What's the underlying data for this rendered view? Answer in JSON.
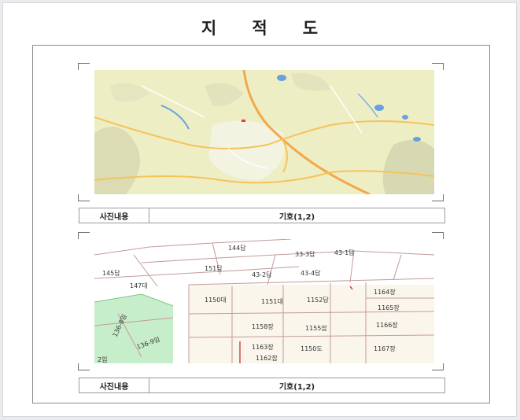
{
  "document": {
    "title": "지 적 도"
  },
  "panels": [
    {
      "image": "topographic-location-map",
      "caption_label": "사진내용",
      "caption_value": "기호(1,2)"
    },
    {
      "image": "cadastral-parcel-map",
      "caption_label": "사진내용",
      "caption_value": "기호(1,2)",
      "parcel_labels": [
        "144답",
        "33-3답",
        "43-1답",
        "145답",
        "147대",
        "151답",
        "43-2답",
        "43-4답",
        "1150대",
        "1151대",
        "1152답",
        "1164장",
        "1165장",
        "1158장",
        "1155잡",
        "1166장",
        "1163장",
        "1150도",
        "1167장",
        "1162잡",
        "136-8임",
        "136-9임",
        "2임"
      ]
    }
  ],
  "colors": {
    "map_land": "#efefc0",
    "map_road": "#f5c35a",
    "map_water": "#6aa0df",
    "parcel_line": "#c49a9a",
    "forest_green": "#bfe8c3"
  }
}
